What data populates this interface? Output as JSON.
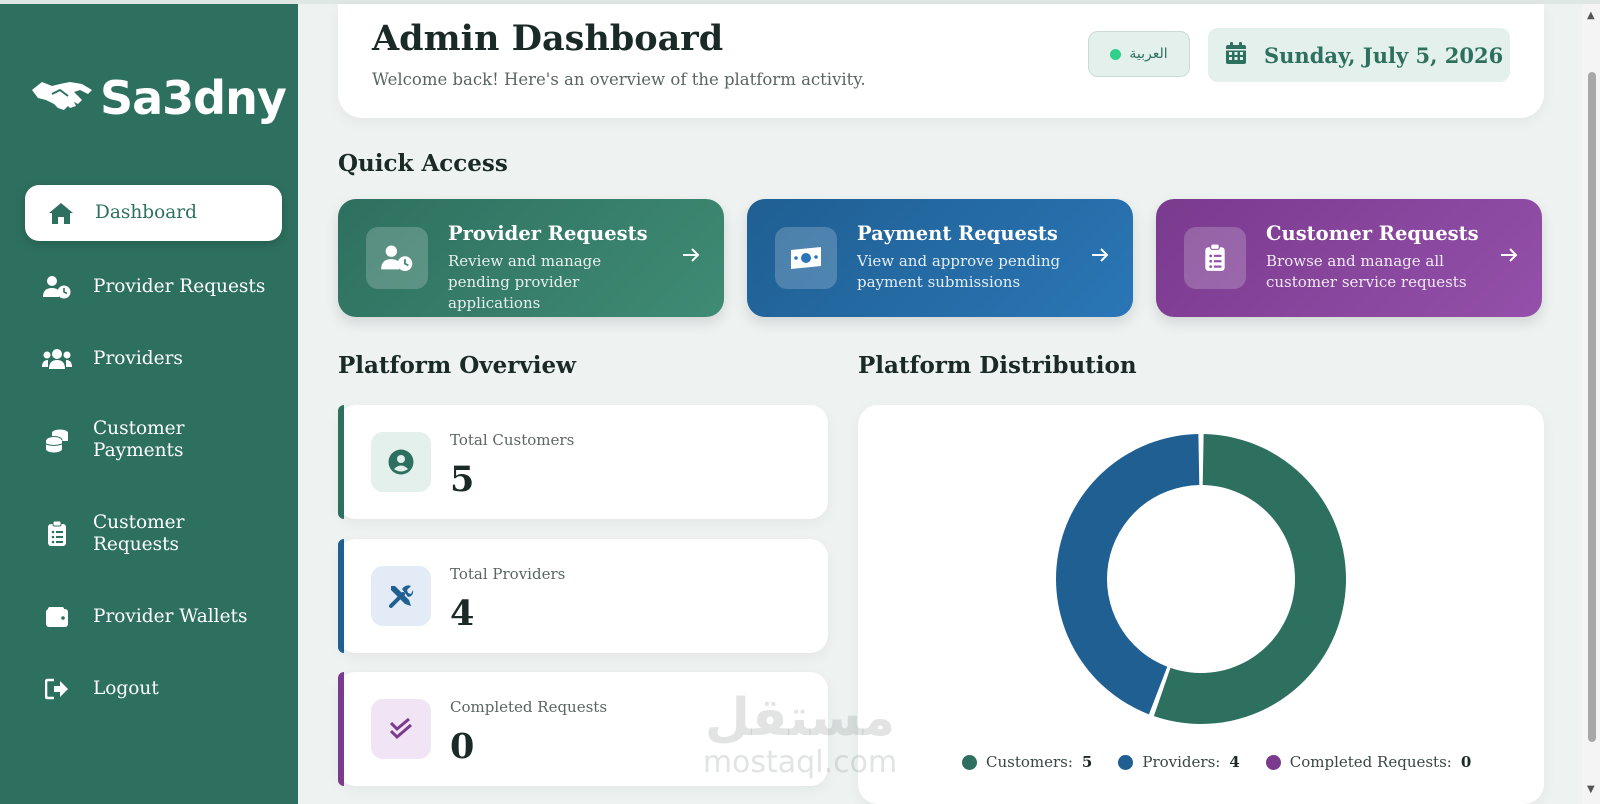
{
  "brand": {
    "logo_text": "Sa3dny"
  },
  "sidebar": {
    "items": [
      {
        "label": "Dashboard",
        "icon": "home-icon",
        "active": true
      },
      {
        "label": "Provider Requests",
        "icon": "user-clock-icon"
      },
      {
        "label": "Providers",
        "icon": "users-icon"
      },
      {
        "label": "Customer\nPayments",
        "icon": "coins-icon"
      },
      {
        "label": "Customer\nRequests",
        "icon": "clipboard-list-icon"
      },
      {
        "label": "Provider Wallets",
        "icon": "wallet-icon"
      },
      {
        "label": "Logout",
        "icon": "sign-out-icon"
      }
    ]
  },
  "header": {
    "title": "Admin Dashboard",
    "subtitle": "Welcome back! Here's an overview of the platform activity.",
    "language_button": "العربية",
    "date": "Sunday, July 5, 2026"
  },
  "quick_access": {
    "title": "Quick Access",
    "cards": [
      {
        "title": "Provider Requests",
        "desc": "Review and manage pending provider applications",
        "color": "#2f7a64",
        "icon": "user-clock-icon"
      },
      {
        "title": "Payment Requests",
        "desc": "View and approve pending payment submissions",
        "color": "#1f5f92",
        "icon": "money-bill-icon"
      },
      {
        "title": "Customer Requests",
        "desc": "Browse and manage all customer service requests",
        "color": "#7a3a8e",
        "icon": "clipboard-list-icon"
      }
    ]
  },
  "overview": {
    "title": "Platform Overview",
    "stats": [
      {
        "label": "Total Customers",
        "value": "5",
        "color": "#2e705f",
        "icon": "user-circle-icon"
      },
      {
        "label": "Total Providers",
        "value": "4",
        "color": "#1f5f92",
        "icon": "tools-icon"
      },
      {
        "label": "Completed Requests",
        "value": "0",
        "color": "#7a3a8e",
        "icon": "double-check-icon"
      }
    ]
  },
  "distribution": {
    "title": "Platform Distribution",
    "legend": [
      {
        "label": "Customers:",
        "value": "5",
        "color": "#2e705f"
      },
      {
        "label": "Providers:",
        "value": "4",
        "color": "#1f5f92"
      },
      {
        "label": "Completed Requests:",
        "value": "0",
        "color": "#7a3a8e"
      }
    ]
  },
  "watermark": {
    "arabic": "مستقل",
    "latin": "mostaql.com"
  },
  "chart_data": {
    "type": "pie",
    "categories": [
      "Customers",
      "Providers",
      "Completed Requests"
    ],
    "values": [
      5,
      4,
      0
    ],
    "colors": [
      "#2e705f",
      "#1f5f92",
      "#7a3a8e"
    ],
    "title": "Platform Distribution",
    "donut": true,
    "legend": "bottom"
  }
}
